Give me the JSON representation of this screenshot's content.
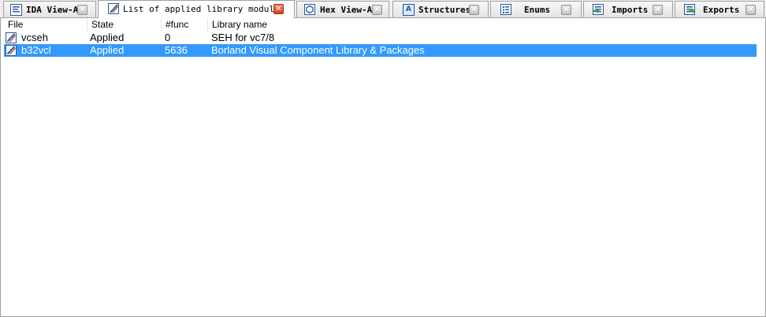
{
  "tabs": [
    {
      "label": "IDA View-A",
      "icon": "disassembly-icon"
    },
    {
      "label": "List of applied library modules",
      "icon": "library-icon"
    },
    {
      "label": "Hex View-A",
      "icon": "hex-icon"
    },
    {
      "label": "Structures",
      "icon": "structures-icon"
    },
    {
      "label": "Enums",
      "icon": "enums-icon"
    },
    {
      "label": "Imports",
      "icon": "imports-icon"
    },
    {
      "label": "Exports",
      "icon": "exports-icon"
    }
  ],
  "active_tab": "List of applied library modules",
  "close_glyph": "✕",
  "table": {
    "columns": [
      "File",
      "State",
      "#func",
      "Library name"
    ],
    "rows": [
      {
        "file": "vcseh",
        "state": "Applied",
        "func": "0",
        "library": "SEH for vc7/8",
        "selected": false
      },
      {
        "file": "b32vcl",
        "state": "Applied",
        "func": "5636",
        "library": "Borland Visual Component Library & Packages",
        "selected": true
      }
    ]
  },
  "colors": {
    "selection": "#3399ff",
    "active_close": "#d0421c"
  }
}
